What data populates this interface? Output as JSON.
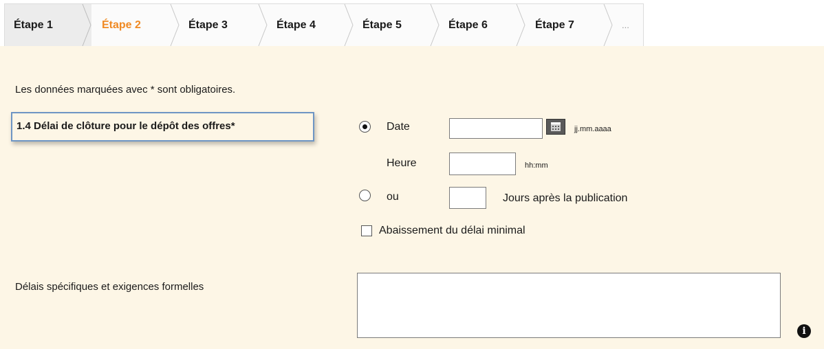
{
  "tabs": {
    "step1": "Étape 1",
    "step2": "Étape 2",
    "step3": "Étape 3",
    "step4": "Étape 4",
    "step5": "Étape 5",
    "step6": "Étape 6",
    "step7": "Étape 7",
    "more": "..."
  },
  "colors": {
    "active_tab": "#f08a24",
    "panel_bg": "#fdf6e6",
    "label_border": "#6d95c4"
  },
  "form": {
    "mandatory_note": "Les données marquées avec * sont obligatoires.",
    "section_label": "1.4 Délai de clôture pour le dépôt des offres*",
    "option_date": {
      "label": "Date",
      "selected": true,
      "date_value": "",
      "date_hint": "jj.mm.aaaa",
      "time_label": "Heure",
      "time_value": "",
      "time_hint": "hh:mm"
    },
    "option_days": {
      "label": "ou",
      "selected": false,
      "days_value": "",
      "days_suffix": "Jours après la publication"
    },
    "reduction_checkbox": {
      "label": "Abaissement du délai minimal",
      "checked": false
    },
    "specific_deadlines": {
      "label": "Délais spécifiques et exigences formelles",
      "value": ""
    },
    "info_icon": "i"
  }
}
